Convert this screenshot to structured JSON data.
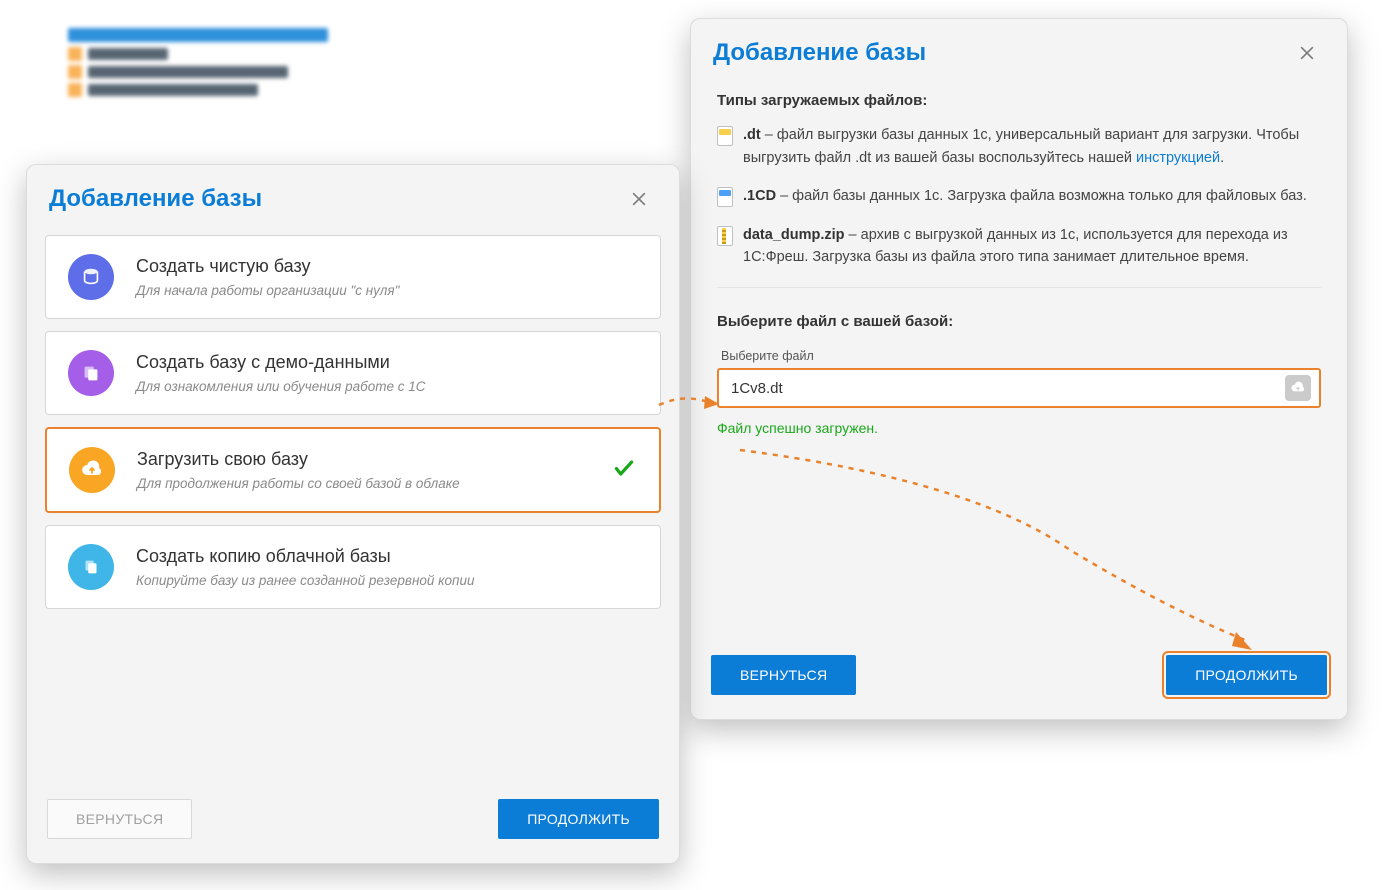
{
  "bg_fragment_visible": true,
  "left_panel": {
    "title": "Добавление базы",
    "options": [
      {
        "title": "Создать чистую базу",
        "sub": "Для начала работы организации \"с нуля\"",
        "icon": "db-icon",
        "color": "blue",
        "selected": false
      },
      {
        "title": "Создать базу с демо-данными",
        "sub": "Для ознакомления или обучения работе с 1С",
        "icon": "db-demo-icon",
        "color": "purple",
        "selected": false
      },
      {
        "title": "Загрузить свою базу",
        "sub": "Для продолжения работы со своей базой в облаке",
        "icon": "db-upload-icon",
        "color": "orange",
        "selected": true
      },
      {
        "title": "Создать копию облачной базы",
        "sub": "Копируйте базу из ранее созданной резервной копии",
        "icon": "db-copy-icon",
        "color": "cyan",
        "selected": false
      }
    ],
    "back_label": "ВЕРНУТЬСЯ",
    "continue_label": "ПРОДОЛЖИТЬ"
  },
  "right_panel": {
    "title": "Добавление базы",
    "section_label": "Типы загружаемых файлов:",
    "file_types": [
      {
        "ext": ".dt",
        "desc_prefix": " – файл выгрузки базы данных 1с, универсальный вариант для загрузки. Чтобы выгрузить файл .dt из вашей базы воспользуйтесь нашей ",
        "link": "инструкцией",
        "desc_suffix": ".",
        "icon": "yellow"
      },
      {
        "ext": ".1CD",
        "desc_prefix": " – файл базы данных 1с. Загрузка файла возможна только для файловых баз.",
        "link": "",
        "desc_suffix": "",
        "icon": "blue"
      },
      {
        "ext": "data_dump.zip",
        "desc_prefix": " – архив с выгрузкой данных из 1с, используется для перехода из 1С:Фреш. Загрузка базы из файла этого типа занимает длительное время.",
        "link": "",
        "desc_suffix": "",
        "icon": "zip"
      }
    ],
    "select_label": "Выберите файл с вашей базой:",
    "field_label": "Выберите файл",
    "file_value": "1Cv8.dt",
    "success_msg": "Файл успешно загружен.",
    "back_label": "ВЕРНУТЬСЯ",
    "continue_label": "ПРОДОЛЖИТЬ"
  }
}
